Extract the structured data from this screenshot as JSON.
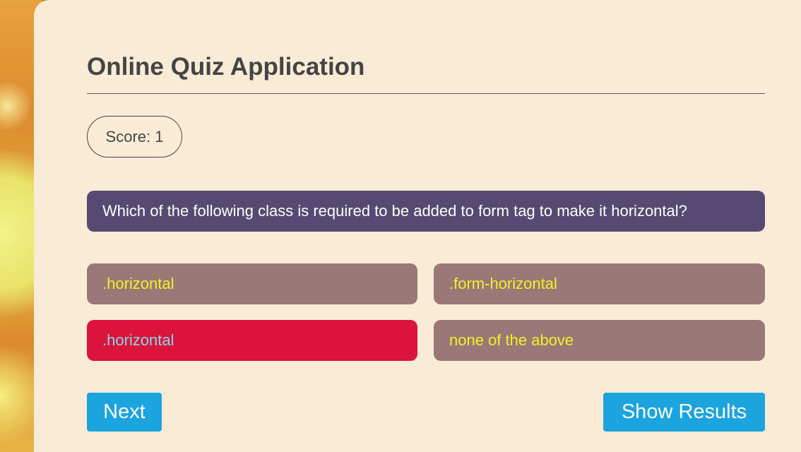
{
  "app": {
    "title": "Online Quiz Application"
  },
  "score": {
    "label": "Score: 1"
  },
  "question": {
    "text": "Which of the following class is required to be added to form tag to make it horizontal?"
  },
  "options": [
    {
      "label": ".horizontal",
      "state": "default"
    },
    {
      "label": ".form-horizontal",
      "state": "default"
    },
    {
      "label": ".horizontal",
      "state": "selected-wrong"
    },
    {
      "label": "none of the above",
      "state": "default"
    }
  ],
  "buttons": {
    "next": "Next",
    "show_results": "Show Results"
  },
  "colors": {
    "card_background": "#faebd7",
    "question_background": "#574a72",
    "option_background": "#9a7878",
    "option_text": "#f1f124",
    "wrong_option_background": "#dc143c",
    "wrong_option_text": "#7fdbea",
    "button_background": "#1ba4dd",
    "title_text": "#444444"
  }
}
